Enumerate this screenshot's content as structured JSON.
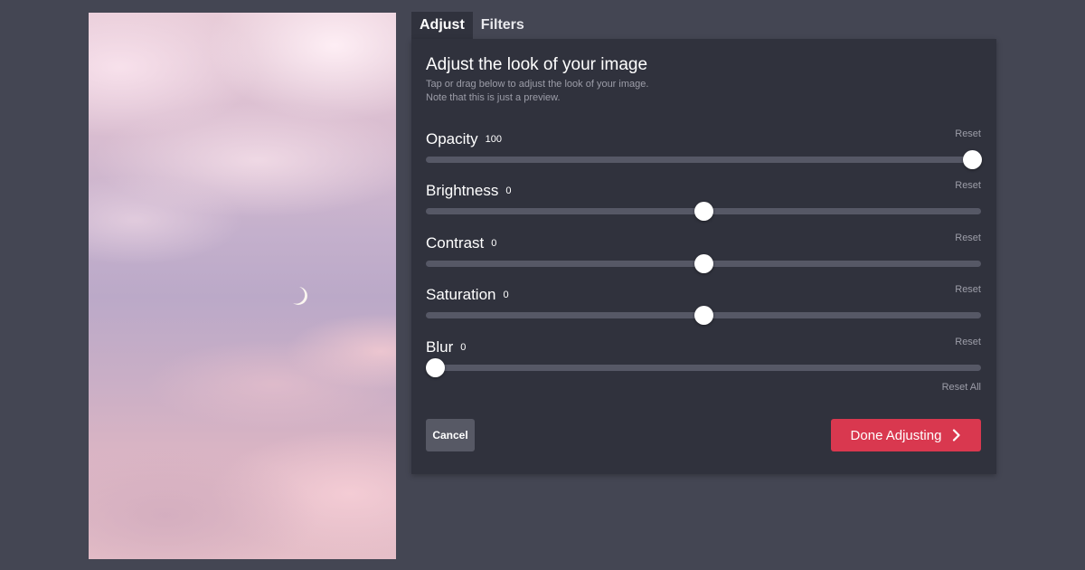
{
  "tabs": [
    {
      "label": "Adjust",
      "active": true
    },
    {
      "label": "Filters",
      "active": false
    }
  ],
  "panel": {
    "title": "Adjust the look of your image",
    "description_line1": "Tap or drag below to adjust the look of your image.",
    "description_line2": "Note that this is just a preview."
  },
  "controls": [
    {
      "label": "Opacity",
      "value": "100",
      "reset": "Reset",
      "position": 1.0
    },
    {
      "label": "Brightness",
      "value": "0",
      "reset": "Reset",
      "position": 0.5
    },
    {
      "label": "Contrast",
      "value": "0",
      "reset": "Reset",
      "position": 0.5
    },
    {
      "label": "Saturation",
      "value": "0",
      "reset": "Reset",
      "position": 0.5
    },
    {
      "label": "Blur",
      "value": "0",
      "reset": "Reset",
      "position": 0.0
    }
  ],
  "actions": {
    "reset_all": "Reset All",
    "cancel": "Cancel",
    "done": "Done Adjusting"
  },
  "colors": {
    "background": "#444653",
    "panel": "#30323d",
    "accent": "#d9384f",
    "muted_text": "#9c9da8"
  },
  "icons": {
    "done_icon": "chevron-right-icon",
    "moon": "crescent-moon"
  }
}
